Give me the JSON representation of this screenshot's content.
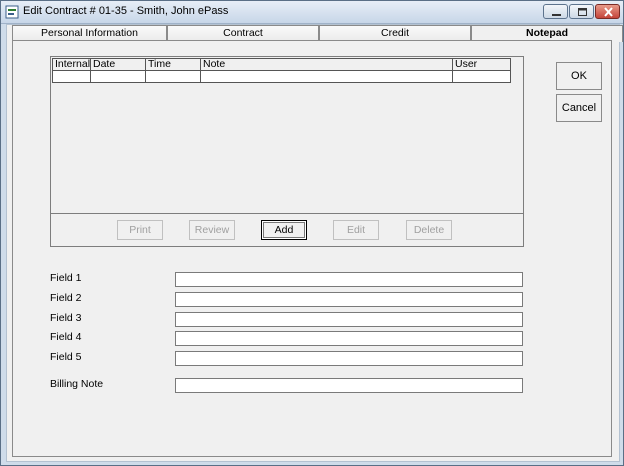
{
  "window": {
    "title": "Edit Contract # 01-35 - Smith, John ePass",
    "app_icon": "app-document-icon",
    "controls": [
      "minimize-icon",
      "maximize-icon",
      "close-icon"
    ]
  },
  "tabs": [
    {
      "label": "Personal Information",
      "active": false
    },
    {
      "label": "Contract",
      "active": false
    },
    {
      "label": "Credit",
      "active": false
    },
    {
      "label": "Notepad",
      "active": true
    }
  ],
  "notes_grid": {
    "columns": [
      "Internal",
      "Date",
      "Time",
      "Note",
      "User"
    ],
    "rows": [
      [
        "",
        "",
        "",
        "",
        ""
      ]
    ]
  },
  "grid_buttons": {
    "print": "Print",
    "review": "Review",
    "add": "Add",
    "edit": "Edit",
    "delete": "Delete"
  },
  "side_buttons": {
    "ok": "OK",
    "cancel": "Cancel"
  },
  "fields": [
    {
      "label": "Field 1",
      "value": ""
    },
    {
      "label": "Field 2",
      "value": ""
    },
    {
      "label": "Field 3",
      "value": ""
    },
    {
      "label": "Field 4",
      "value": ""
    },
    {
      "label": "Field 5",
      "value": ""
    },
    {
      "label": "Billing Note",
      "value": ""
    }
  ]
}
